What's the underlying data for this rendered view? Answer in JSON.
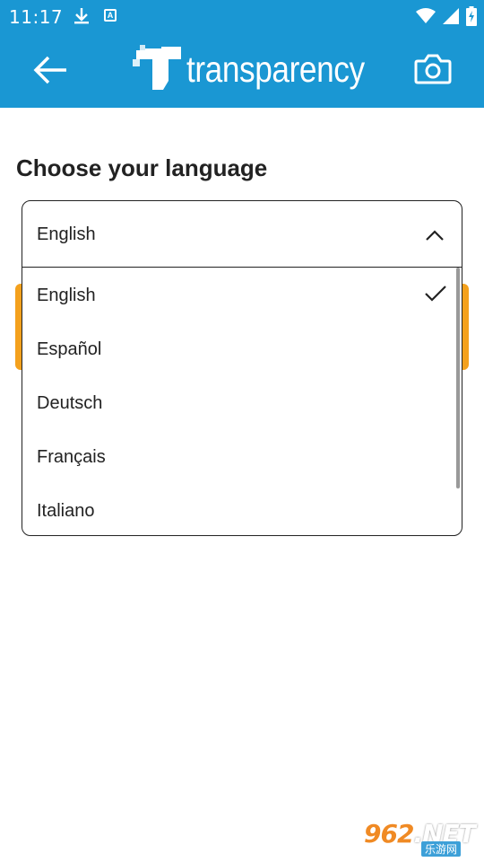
{
  "status_bar": {
    "time": "11:17",
    "icons": [
      "download-icon",
      "a-notification-icon",
      "wifi-icon",
      "signal-icon",
      "battery-charging-icon"
    ]
  },
  "app_bar": {
    "brand_name": "transparency",
    "back_icon": "back-arrow-icon",
    "camera_icon": "camera-icon",
    "color": "#1a97d3"
  },
  "page": {
    "title": "Choose your language"
  },
  "language_select": {
    "selected": "English",
    "options": [
      {
        "label": "English",
        "checked": true
      },
      {
        "label": "Español",
        "checked": false
      },
      {
        "label": "Deutsch",
        "checked": false
      },
      {
        "label": "Français",
        "checked": false
      },
      {
        "label": "Italiano",
        "checked": false
      }
    ]
  },
  "accent_color": "#f4a11d",
  "watermark": {
    "main": "962",
    "suffix": ".NET",
    "sub": "乐游网"
  }
}
